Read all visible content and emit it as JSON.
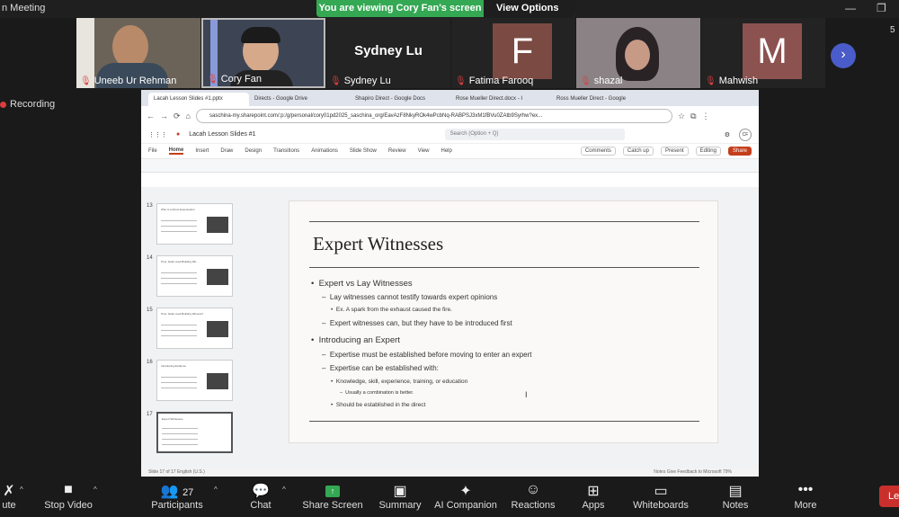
{
  "window": {
    "title": "n Meeting"
  },
  "banner": {
    "message": "You are viewing Cory Fan's screen",
    "options_label": "View Options"
  },
  "participants": [
    {
      "name": "Uneeb Ur Rehman",
      "muted": true
    },
    {
      "name": "Cory Fan",
      "muted": true
    },
    {
      "name": "Sydney Lu",
      "muted": true,
      "display": "Sydney Lu"
    },
    {
      "name": "Fatima Farooq",
      "muted": true,
      "initial": "F",
      "color": "#7b4a42"
    },
    {
      "name": "shazal",
      "muted": true
    },
    {
      "name": "Mahwish",
      "muted": true,
      "initial": "M",
      "color": "#8c5250"
    }
  ],
  "side_count": "5",
  "recording_label": "Recording",
  "browser": {
    "tabs": [
      "Lacah Lesson Slides #1.pptx",
      "Directs - Google Drive",
      "Shapiro Direct - Google Docs",
      "Rose Mueller Direct.docx - I",
      "Ross Mueller Direct - Google"
    ],
    "url": "saschina-my.sharepoint.com/:p:/g/personal/cory01pd2025_saschina_org/EavAzF8NkyROk4wPcbNq-RABPSJ3xM1fBVu0ZAtb9Syrhw?ex...",
    "doc_title": "Lacah Lesson Slides #1",
    "search_placeholder": "Search (Option + Q)",
    "user_initials": "CF",
    "menu": [
      "File",
      "Home",
      "Insert",
      "Draw",
      "Design",
      "Transitions",
      "Animations",
      "Slide Show",
      "Review",
      "View",
      "Help"
    ],
    "menu_active": "Home",
    "actions": {
      "comments": "Comments",
      "catchup": "Catch up",
      "present": "Present",
      "editing": "Editing",
      "share": "Share"
    },
    "status": {
      "left": "Slide 17 of 17   English (U.S.)",
      "right": "Notes   Give Feedback to Microsoft     79%"
    }
  },
  "thumbnails": [
    {
      "num": "13",
      "title": "Who is a Direct Examination"
    },
    {
      "num": "14",
      "title": "Pros: bullet cued Building Wit..."
    },
    {
      "num": "15",
      "title": "Pros: bullet cued Building Witness?"
    },
    {
      "num": "16",
      "title": "Introducing Evidence"
    },
    {
      "num": "17",
      "title": "Expert Witnesses",
      "selected": true
    }
  ],
  "slide": {
    "title": "Expert Witnesses",
    "bullets": [
      {
        "level": 1,
        "text": "Expert vs Lay Witnesses"
      },
      {
        "level": 2,
        "text": "Lay witnesses cannot testify towards expert opinions"
      },
      {
        "level": 3,
        "text": "Ex. A spark from the exhaust caused the fire."
      },
      {
        "level": 2,
        "text": "Expert witnesses can, but they have to be introduced first"
      },
      {
        "level": 1,
        "text": "Introducing an Expert"
      },
      {
        "level": 2,
        "text": "Expertise must be established before moving to enter an expert"
      },
      {
        "level": 2,
        "text": "Expertise can be established with:"
      },
      {
        "level": 3,
        "text": "Knowledge, skill, experience, training, or education"
      },
      {
        "level": 4,
        "text": "Usually a combination is better."
      },
      {
        "level": 3,
        "text": "Should be established in the direct"
      }
    ]
  },
  "toolbar": {
    "mute": "ute",
    "stop_video": "Stop Video",
    "participants": "Participants",
    "participant_count": "27",
    "chat": "Chat",
    "share_screen": "Share Screen",
    "summary": "Summary",
    "ai_companion": "AI Companion",
    "reactions": "Reactions",
    "apps": "Apps",
    "whiteboards": "Whiteboards",
    "notes": "Notes",
    "more": "More",
    "leave": "Le"
  }
}
